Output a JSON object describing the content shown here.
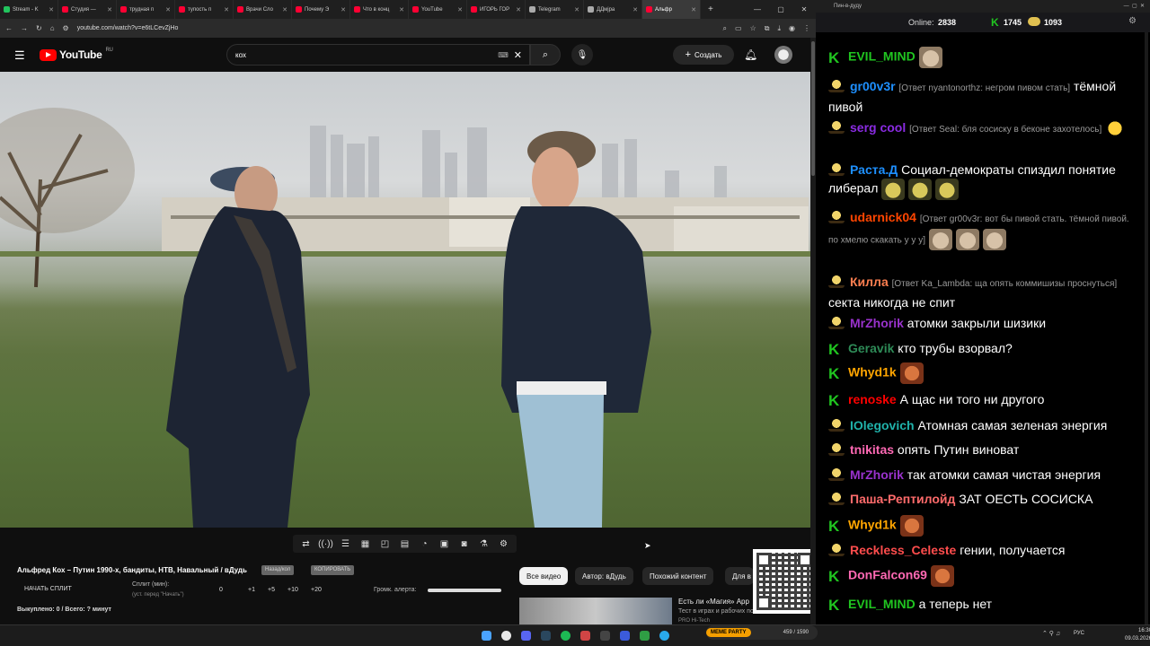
{
  "browser": {
    "tabs": [
      {
        "label": "Stream - K",
        "color": "#22c55e"
      },
      {
        "label": "Студия —",
        "color": "#ff0033"
      },
      {
        "label": "трудная п",
        "color": "#ff0033"
      },
      {
        "label": "тупость п",
        "color": "#ff0033"
      },
      {
        "label": "Врачи Сло",
        "color": "#ff0033"
      },
      {
        "label": "Почему Э",
        "color": "#ff0033"
      },
      {
        "label": "Что в конц",
        "color": "#ff0033"
      },
      {
        "label": "YouTube",
        "color": "#ff0033"
      },
      {
        "label": "ИГОРЬ ГОР",
        "color": "#ff0033"
      },
      {
        "label": "Telegram",
        "color": "#aaaaaa"
      },
      {
        "label": "ДДмjра",
        "color": "#aaaaaa"
      },
      {
        "label": "Альфр",
        "color": "#ff0033"
      }
    ],
    "url": "youtube.com/watch?v=e6tLCevZjHo"
  },
  "youtube": {
    "logo_text": "YouTube",
    "logo_region": "RU",
    "search_value": "кох",
    "create_label": "Создать"
  },
  "below_player": {
    "title": "Альфред Кох – Путин 1990-х, бандиты, НТВ, Навальный / вДудь",
    "badge_nazad": "Назад/кол",
    "badge_copy": "КОПИРОВАТЬ",
    "start_split": "НАЧАТЬ СПЛИТ",
    "split_label": "Сплит (мин):",
    "split_hint": "(уст. перед \"Начать\")",
    "split_values": [
      "0",
      "+1",
      "+5",
      "+10",
      "+20"
    ],
    "volume_label": "Громк. алерта:",
    "bought": "Выкуплено: 0 / Всего: ? минут",
    "chips": [
      "Все видео",
      "Автор: вДудь",
      "Похожий контент",
      "Для в"
    ],
    "rec_title": "Есть ли «Магия» App",
    "rec_sub": "Тест в играх и рабочих по...",
    "rec_channel": "PRO Hi-Tech"
  },
  "chat": {
    "window_title": "Пин-в-дуду",
    "online_label": "Online:",
    "online_count": "2838",
    "count_a": "1745",
    "count_b": "1093",
    "messages": [
      {
        "badge": "k",
        "user": "EVIL_MIND",
        "color": "#20c520",
        "reply": "",
        "text": "",
        "emotes": [
          "cat"
        ]
      },
      {
        "badge": "c",
        "user": "gr00v3r",
        "color": "#1e90ff",
        "reply": "[Ответ nyantonorthz: негром пивом стать]",
        "text": "тёмной пивой",
        "emotes": []
      },
      {
        "badge": "c",
        "user": "serg cool",
        "color": "#8a2be2",
        "reply": "[Ответ Seal: бля сосиску в беконе захотелось]",
        "text": "",
        "emotes": [
          "smile"
        ]
      },
      {
        "badge": "c",
        "user": "Раста.Д",
        "color": "#1e90ff",
        "reply": "",
        "text": "Социал-демократы спиздил понятие либерал",
        "emotes": [
          "pepe",
          "pepe",
          "pepe"
        ]
      },
      {
        "badge": "c",
        "user": "udarnick04",
        "color": "#ff4500",
        "reply": "[Ответ gr00v3r: вот бы пивой стать. тёмной пивой. по хмелю скакать у у у]",
        "text": "",
        "emotes": [
          "cat",
          "cat",
          "cat"
        ]
      },
      {
        "badge": "c",
        "user": "Килла",
        "color": "#ff7f50",
        "reply": "[Ответ Ka_Lambda: ща опять коммишизы проснуться]",
        "text": "секта никогда не спит",
        "emotes": []
      },
      {
        "badge": "c",
        "user": "MrZhorik",
        "color": "#9932cc",
        "reply": "",
        "text": "атомки закрыли шизики",
        "emotes": []
      },
      {
        "badge": "k",
        "user": "Geravik",
        "color": "#2e8b57",
        "reply": "",
        "text": "кто трубы взорвал?",
        "emotes": []
      },
      {
        "badge": "k",
        "user": "Whyd1k",
        "color": "#ffa500",
        "reply": "",
        "text": "",
        "emotes": [
          "face"
        ]
      },
      {
        "badge": "k",
        "user": "renoske",
        "color": "#ff0000",
        "reply": "",
        "text": "А щас ни того ни другого",
        "emotes": []
      },
      {
        "badge": "c",
        "user": "IOlegovich",
        "color": "#20b2aa",
        "reply": "",
        "text": "Атомная самая зеленая энергия",
        "emotes": []
      },
      {
        "badge": "c",
        "user": "tnikitas",
        "color": "#ff69b4",
        "reply": "",
        "text": "опять Путин виноват",
        "emotes": []
      },
      {
        "badge": "c",
        "user": "MrZhorik",
        "color": "#9932cc",
        "reply": "",
        "text": "так атомки самая чистая энергия",
        "emotes": []
      },
      {
        "badge": "c",
        "user": "Паша-Рептилойд",
        "color": "#ff6b6b",
        "reply": "",
        "text": "ЗАТ ОЕСТЬ СОСИСКА",
        "emotes": []
      },
      {
        "badge": "k",
        "user": "Whyd1k",
        "color": "#ffa500",
        "reply": "",
        "text": "",
        "emotes": [
          "face"
        ]
      },
      {
        "badge": "c",
        "user": "Reckless_Celeste",
        "color": "#ff4d4d",
        "reply": "",
        "text": "гении, получается",
        "emotes": []
      },
      {
        "badge": "k",
        "user": "DonFalcon69",
        "color": "#ff69b4",
        "reply": "",
        "text": "",
        "emotes": [
          "face"
        ]
      },
      {
        "badge": "k",
        "user": "EVIL_MIND",
        "color": "#20c520",
        "reply": "",
        "text": "а теперь нет",
        "emotes": []
      }
    ]
  },
  "taskbar": {
    "meme_label": "MEME PARTY",
    "meme_count": "459 / 1590",
    "lang": "РУС",
    "time": "16:30",
    "date": "09.03.2026"
  }
}
